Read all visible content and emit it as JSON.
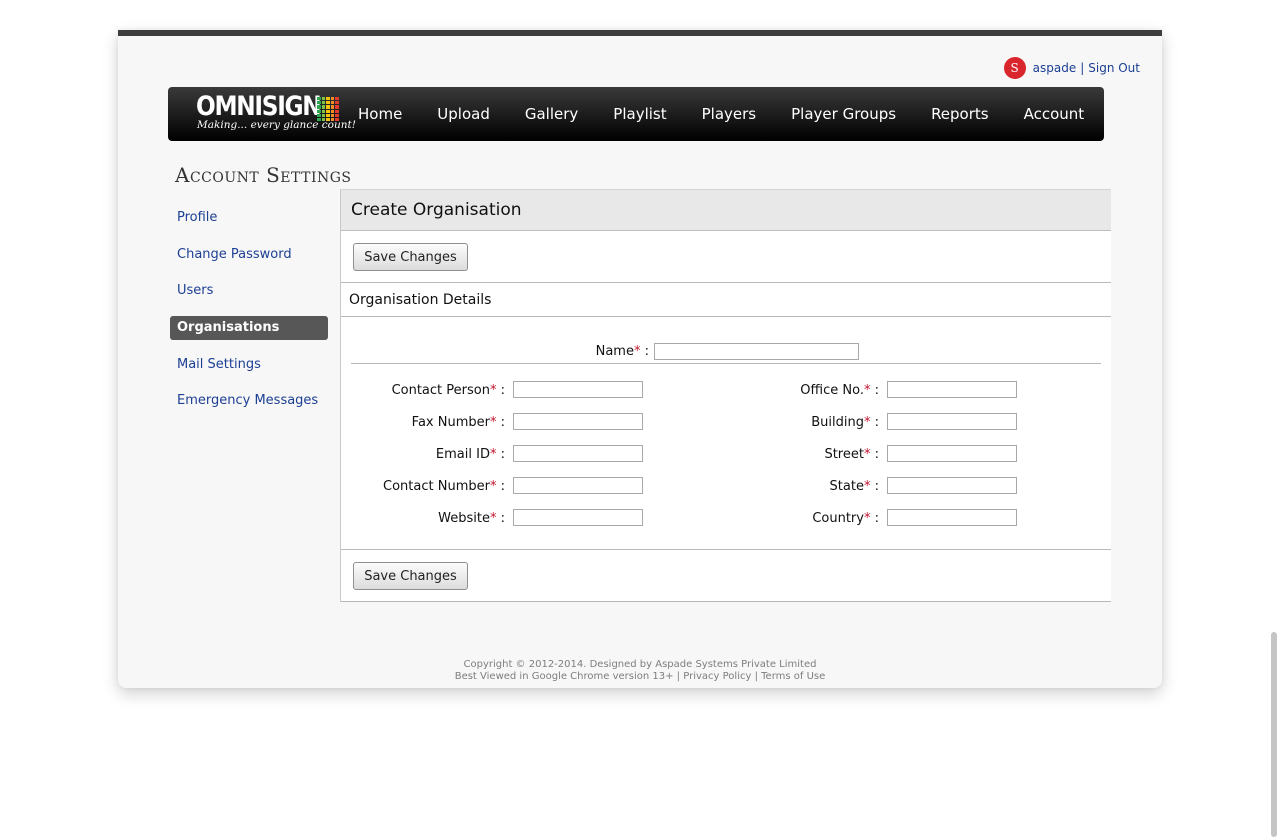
{
  "user": {
    "avatar_letter": "S",
    "username": "aspade",
    "separator": "|",
    "sign_out": "Sign Out"
  },
  "logo": {
    "word": "OMNISIGN",
    "tagline": "Making... every glance count!"
  },
  "nav": {
    "items": [
      "Home",
      "Upload",
      "Gallery",
      "Playlist",
      "Players",
      "Player Groups",
      "Reports",
      "Account"
    ]
  },
  "page_title": "Account Settings",
  "sidebar": {
    "items": [
      "Profile",
      "Change Password",
      "Users",
      "Organisations",
      "Mail Settings",
      "Emergency Messages"
    ],
    "active": "Organisations"
  },
  "panel": {
    "title": "Create Organisation",
    "save_label": "Save Changes",
    "section_title": "Organisation Details",
    "name_label": "Name",
    "left_fields": [
      "Contact Person",
      "Fax Number",
      "Email ID",
      "Contact Number",
      "Website"
    ],
    "right_fields": [
      "Office No.",
      "Building",
      "Street",
      "State",
      "Country"
    ],
    "required_mark": "*",
    "colon": ":"
  },
  "footer": {
    "copyright": "Copyright © 2012-2014. Designed by Aspade Systems Private Limited",
    "best_viewed": "Best Viewed in Google Chrome version 13+",
    "divider": "|",
    "privacy": "Privacy Policy",
    "terms": "Terms of Use"
  },
  "colors": {
    "avatar": "#d9262c",
    "link": "#1c3f94",
    "required": "#c0142b",
    "active_tab": "#575757"
  }
}
